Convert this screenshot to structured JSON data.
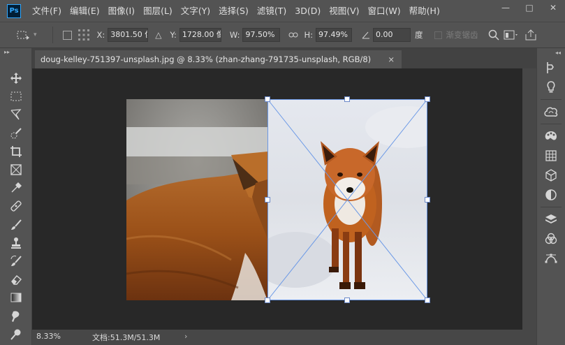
{
  "app": {
    "logo": "Ps"
  },
  "menu": [
    "文件(F)",
    "编辑(E)",
    "图像(I)",
    "图层(L)",
    "文字(Y)",
    "选择(S)",
    "滤镜(T)",
    "3D(D)",
    "视图(V)",
    "窗口(W)",
    "帮助(H)"
  ],
  "window_controls": {
    "minimize": "—",
    "maximize": "□",
    "close": "✕"
  },
  "options": {
    "x_label": "X:",
    "x_value": "3801.50 像",
    "y_label": "Y:",
    "y_value": "1728.00 像",
    "w_label": "W:",
    "w_value": "97.50%",
    "h_label": "H:",
    "h_value": "97.49%",
    "angle_value": "0.00",
    "angle_unit": "度",
    "interp_label": "渐变锯齿"
  },
  "document": {
    "tab_title": "doug-kelley-751397-unsplash.jpg @ 8.33% (zhan-zhang-791735-unsplash, RGB/8)",
    "tab_close": "×"
  },
  "status": {
    "zoom": "8.33%",
    "doc_info": "文档:51.3M/51.3M",
    "arrow": "›"
  },
  "icons": {
    "left_tools": [
      "move-icon",
      "marquee-icon",
      "lasso-icon",
      "quick-select-icon",
      "crop-icon",
      "frame-icon",
      "eyedropper-icon",
      "healing-brush-icon",
      "brush-icon",
      "clone-stamp-icon",
      "history-brush-icon",
      "eraser-icon",
      "gradient-icon",
      "smudge-icon",
      "dodge-icon"
    ],
    "right_panels": [
      "history-icon",
      "learn-icon",
      "libraries-icon",
      "color-icon",
      "swatches-icon",
      "3d-icon",
      "adjustments-icon",
      "layers-icon",
      "channels-icon",
      "paths-icon"
    ]
  },
  "colors": {
    "accent": "#31a8ff",
    "transform_line": "#6a98e6"
  }
}
